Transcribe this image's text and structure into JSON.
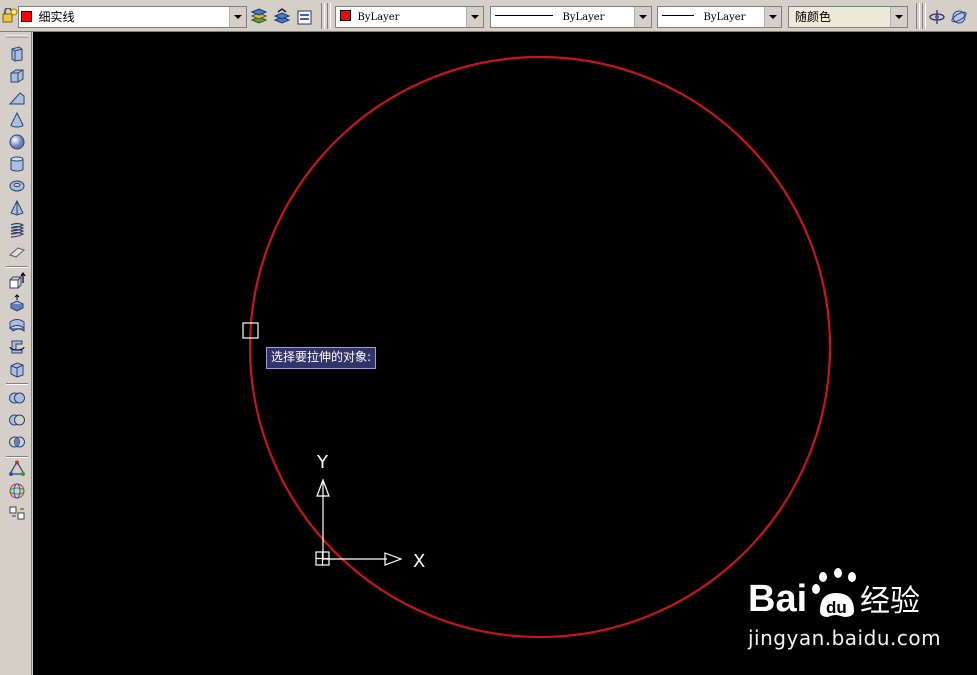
{
  "toolbar": {
    "layer_name": "细实线",
    "layer_color": "#ff0000",
    "color_value": "ByLayer",
    "linetype_value": "ByLayer",
    "lineweight_value": "ByLayer",
    "plotstyle_value": "随颜色"
  },
  "left_toolbar": {
    "icons": [
      "polysolid-icon",
      "box-icon",
      "wedge-icon",
      "cone-icon",
      "sphere-icon",
      "cylinder-icon",
      "torus-icon",
      "pyramid-icon",
      "helix-icon",
      "planar-surface-icon",
      "extrude-icon",
      "presspull-icon",
      "sweep-icon",
      "revolve-icon",
      "loft-icon",
      "union-icon",
      "subtract-icon",
      "intersect-icon",
      "3d-move-icon",
      "3d-rotate-icon",
      "section-plane-icon"
    ]
  },
  "drawing": {
    "background": "#000000",
    "circle_color": "#c8141e",
    "tooltip_text": "选择要拉伸的对象:",
    "ucs_x_label": "X",
    "ucs_y_label": "Y"
  },
  "watermark": {
    "logo_text": "Bai du 经验",
    "url": "jingyan.baidu.com"
  }
}
